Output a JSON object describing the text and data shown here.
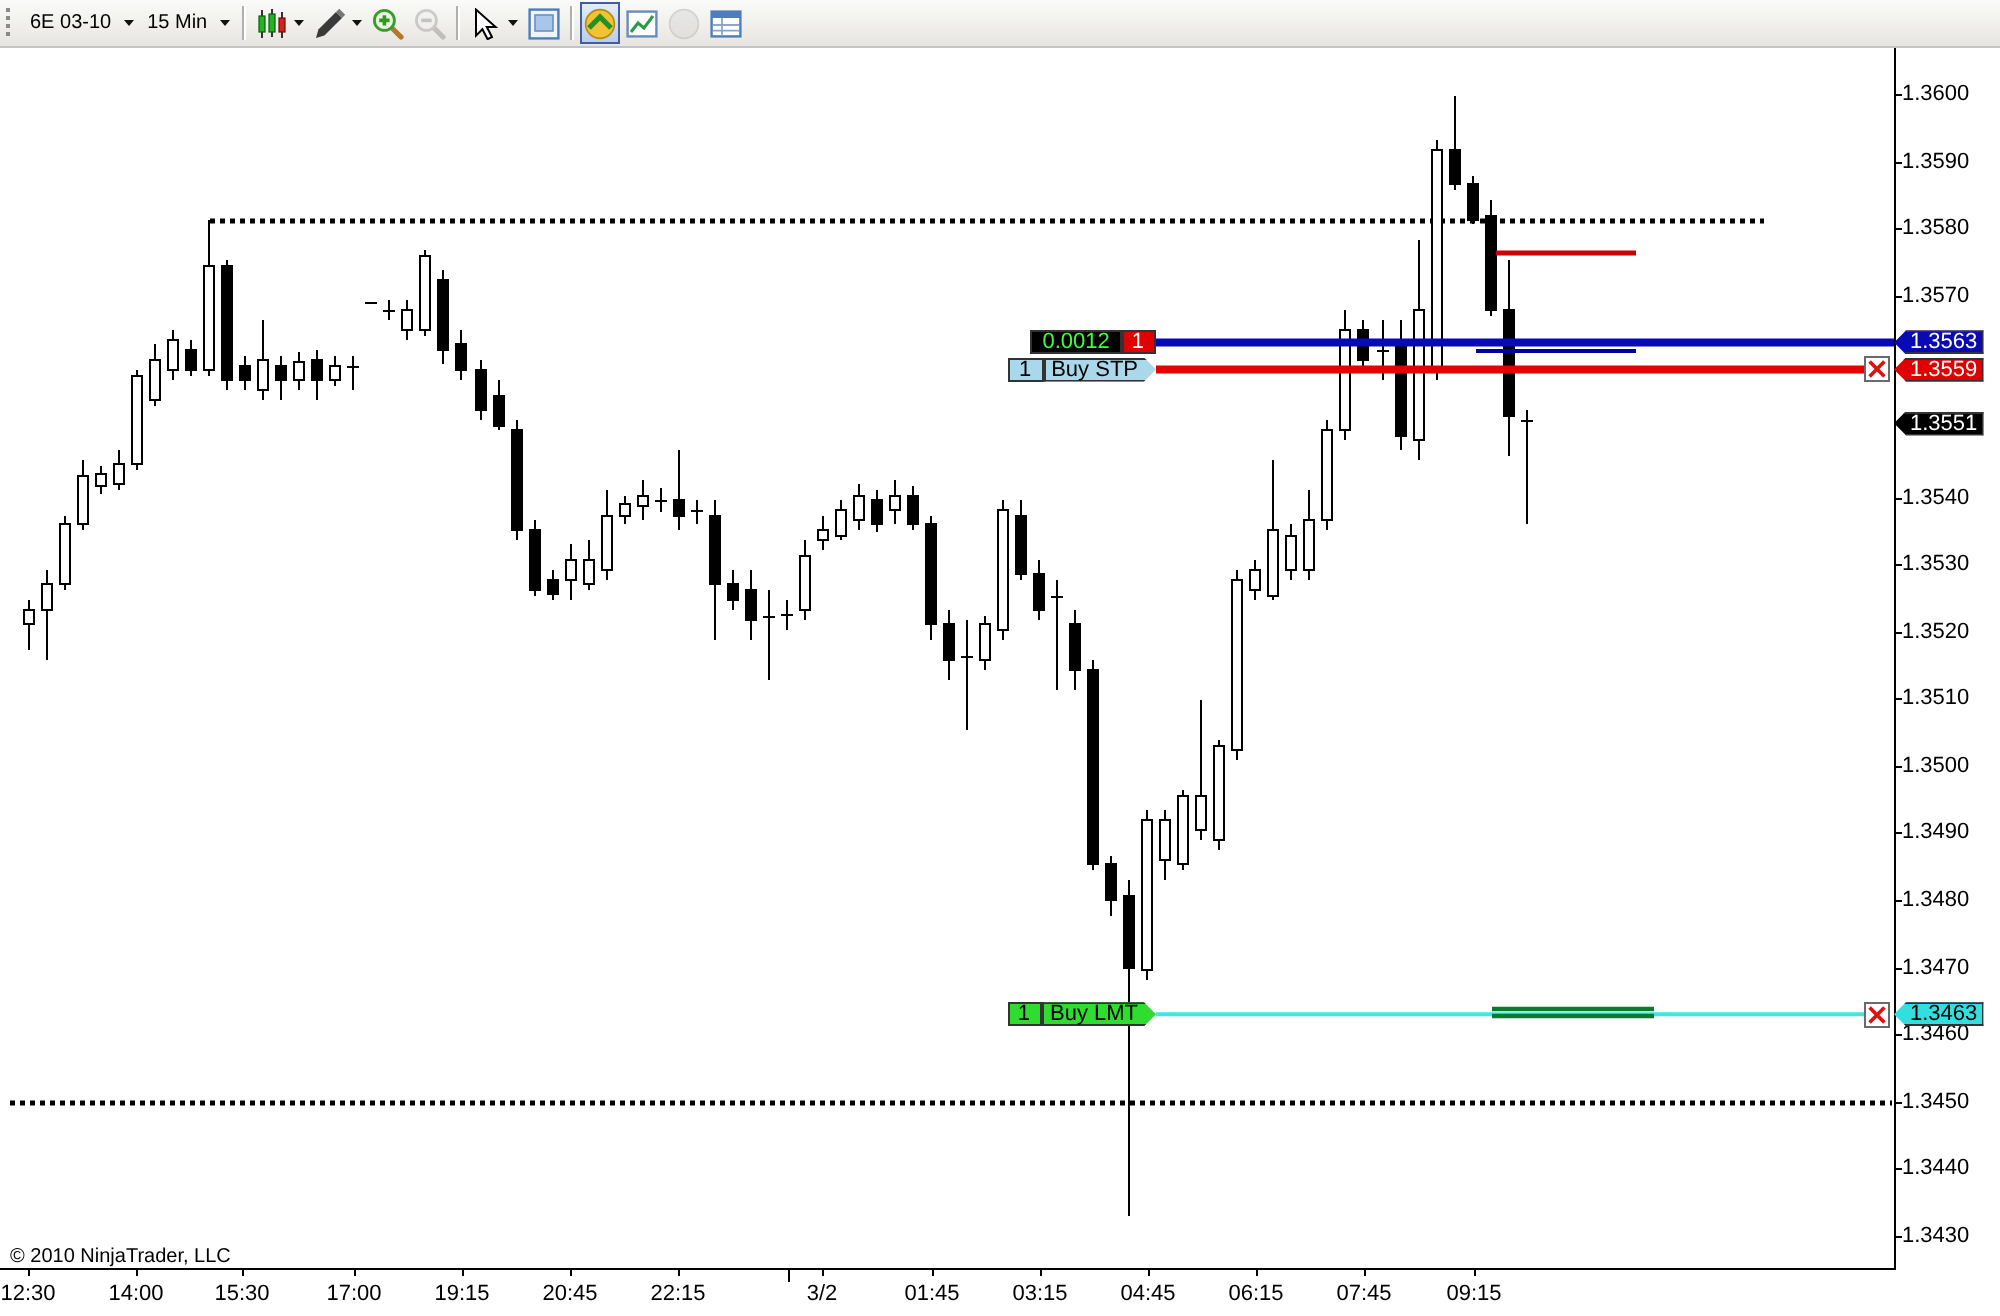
{
  "toolbar": {
    "instrument": "6E 03-10",
    "interval": "15 Min",
    "tool_groups": [
      {
        "tools": [
          {
            "kind": "chart-style",
            "selected": false,
            "disabled": false
          },
          {
            "kind": "drawing-tool",
            "selected": false,
            "disabled": false
          },
          {
            "kind": "zoom-in",
            "selected": false,
            "disabled": false
          },
          {
            "kind": "zoom-out",
            "selected": false,
            "disabled": true
          }
        ]
      },
      {
        "tools": [
          {
            "kind": "pointer",
            "selected": false,
            "disabled": false
          },
          {
            "kind": "properties",
            "selected": false,
            "disabled": false
          }
        ]
      },
      {
        "tools": [
          {
            "kind": "chart-trader",
            "selected": true,
            "disabled": false
          },
          {
            "kind": "indicators",
            "selected": false,
            "disabled": false
          },
          {
            "kind": "strategies",
            "selected": false,
            "disabled": true
          },
          {
            "kind": "data-box",
            "selected": false,
            "disabled": false
          }
        ]
      }
    ]
  },
  "chart": {
    "position": {
      "pnl": "0.0012",
      "quantity": "1",
      "price_tag": "1.3563"
    },
    "orders": [
      {
        "kind": "stop",
        "quantity": "1",
        "label": "Buy STP",
        "price_tag": "1.3559"
      },
      {
        "kind": "limit",
        "quantity": "1",
        "label": "Buy LMT",
        "price_tag": "1.3463"
      }
    ],
    "last_price_tag": "1.3551",
    "price_axis": {
      "labels": [
        "1.3600",
        "1.3590",
        "1.3580",
        "1.3570",
        "1.3540",
        "1.3530",
        "1.3520",
        "1.3510",
        "1.3500",
        "1.3490",
        "1.3480",
        "1.3470",
        "1.3460",
        "1.3450",
        "1.3440",
        "1.3430"
      ]
    },
    "time_axis": {
      "labels": [
        "12:30",
        "14:00",
        "15:30",
        "17:00",
        "19:15",
        "20:45",
        "22:15",
        "3/2",
        "01:45",
        "03:15",
        "04:45",
        "06:15",
        "07:45",
        "09:15"
      ]
    },
    "copyright": "© 2010 NinjaTrader, LLC"
  }
}
